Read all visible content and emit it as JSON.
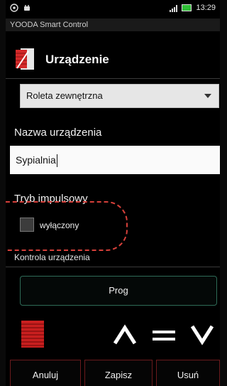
{
  "status_bar": {
    "time": "13:29",
    "icons": [
      "sim-icon",
      "android-icon",
      "signal-icon",
      "battery-icon"
    ]
  },
  "app_name": "YOODA Smart Control",
  "header": {
    "title": "Urządzenie",
    "icon": "blind-device-icon"
  },
  "device_type": {
    "selected": "Roleta zewnętrzna"
  },
  "device_name": {
    "label": "Nazwa urządzenia",
    "value": "Sypialnia"
  },
  "impulse_mode": {
    "label": "Tryb impulsowy",
    "checkbox_label": "wyłączony",
    "checked": false
  },
  "control": {
    "label": "Kontrola urządzenia",
    "prog_button": "Prog",
    "blind_icon": "blind-icon",
    "controls": [
      "up-chevron-icon",
      "stop-icon",
      "down-chevron-icon"
    ]
  },
  "actions": {
    "cancel": "Anuluj",
    "save": "Zapisz",
    "delete": "Usuń"
  },
  "colors": {
    "accent_red": "#d6403a",
    "prog_border": "#2e6b57",
    "background": "#000000"
  }
}
